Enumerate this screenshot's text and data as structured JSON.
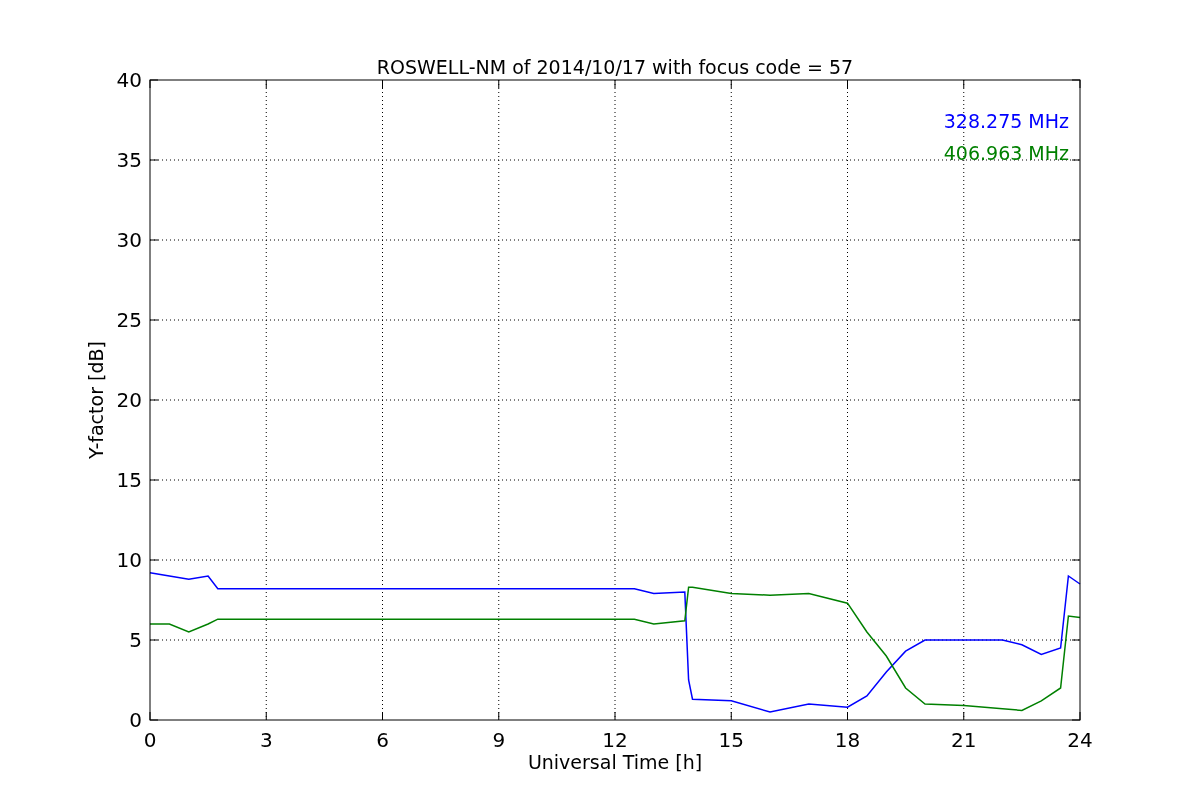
{
  "figure": {
    "chart_data": {
      "type": "line",
      "title": "ROSWELL-NM of 2014/10/17 with focus code = 57",
      "xlabel": "Universal Time [h]",
      "ylabel": "Y-factor [dB]",
      "x": [
        0,
        0.5,
        1,
        1.5,
        1.75,
        6,
        12.5,
        13,
        13.8,
        13.9,
        14,
        15,
        16,
        17,
        18,
        18.5,
        19,
        19.5,
        20,
        21,
        22,
        22.5,
        23,
        23.5,
        23.7,
        24
      ],
      "series": [
        {
          "name": "328.275 MHz",
          "color": "#0000ff",
          "values": [
            9.2,
            9,
            8.8,
            9,
            8.2,
            8.2,
            8.2,
            7.9,
            8,
            2.5,
            1.3,
            1.2,
            0.5,
            1.0,
            0.8,
            1.5,
            3,
            4.3,
            5,
            5,
            5,
            4.7,
            4.1,
            4.5,
            9,
            8.5
          ]
        },
        {
          "name": "406.963 MHz",
          "color": "#008000",
          "values": [
            6,
            6,
            5.5,
            6,
            6.3,
            6.3,
            6.3,
            6,
            6.2,
            8.3,
            8.3,
            7.9,
            7.8,
            7.9,
            7.3,
            5.5,
            4,
            2,
            1,
            0.9,
            0.7,
            0.6,
            1.2,
            2,
            6.5,
            6.4
          ]
        }
      ],
      "grid": true,
      "xlim": [
        0,
        24
      ],
      "ylim": [
        0,
        40
      ],
      "xticks": [
        0,
        3,
        6,
        9,
        12,
        15,
        18,
        21,
        24
      ],
      "yticks": [
        0,
        5,
        10,
        15,
        20,
        25,
        30,
        35,
        40
      ]
    }
  }
}
